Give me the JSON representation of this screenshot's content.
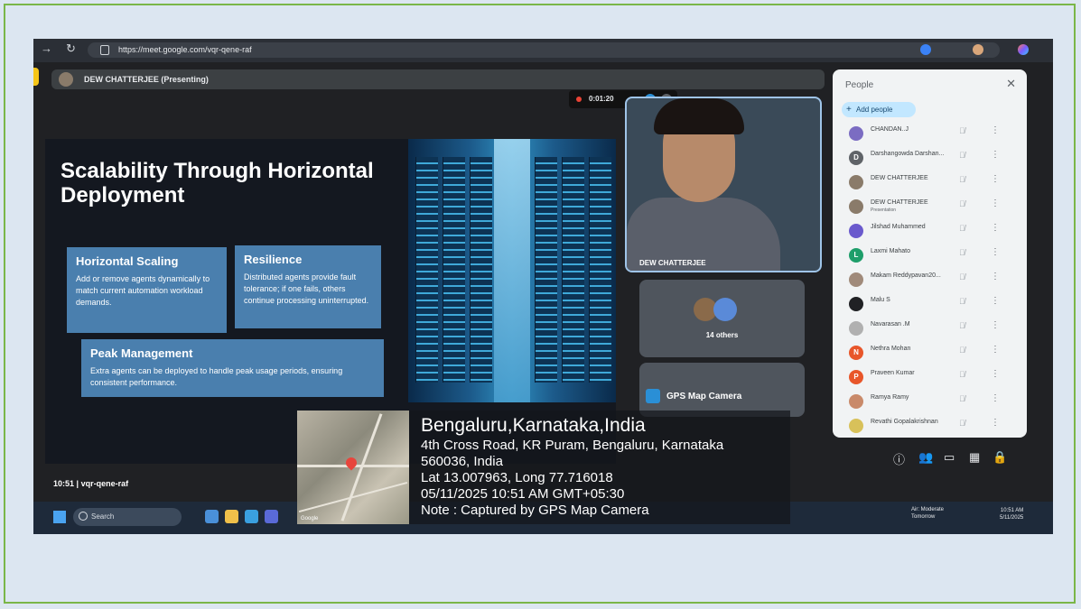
{
  "browser": {
    "url": "https://meet.google.com/vqr-qene-raf"
  },
  "meet": {
    "presenter_label": "DEW CHATTERJEE (Presenting)",
    "record_time": "0:01:20",
    "meeting_time": "10:51",
    "meeting_code": "vqr-qene-raf",
    "main_tile_name": "DEW CHATTERJEE",
    "others_label": "14 others",
    "gps_tile_label": "GPS Map Camera"
  },
  "slide": {
    "title": "Scalability Through Horizontal Deployment",
    "cards": [
      {
        "heading": "Horizontal Scaling",
        "body": "Add or remove agents dynamically to match current automation workload demands."
      },
      {
        "heading": "Resilience",
        "body": "Distributed agents provide fault tolerance; if one fails, others continue processing uninterrupted."
      },
      {
        "heading": "Peak Management",
        "body": "Extra agents can be deployed to handle peak usage periods, ensuring consistent performance."
      }
    ]
  },
  "people": {
    "title": "People",
    "add_label": "Add people",
    "list": [
      {
        "name": "CHANDAN..J",
        "sub": "",
        "initial": "",
        "color": "#7b6cc2"
      },
      {
        "name": "Darshangowda Darshan...",
        "sub": "",
        "initial": "D",
        "color": "#5f6368"
      },
      {
        "name": "DEW CHATTERJEE",
        "sub": "",
        "initial": "",
        "color": "#8a7b6a"
      },
      {
        "name": "DEW CHATTERJEE",
        "sub": "Presentation",
        "initial": "",
        "color": "#8a7b6a"
      },
      {
        "name": "Jilshad Muhammed",
        "sub": "",
        "initial": "",
        "color": "#6a5acd"
      },
      {
        "name": "Laxmi Mahato",
        "sub": "",
        "initial": "L",
        "color": "#1e9e6a"
      },
      {
        "name": "Makam Reddypavan20...",
        "sub": "",
        "initial": "",
        "color": "#a08a7a"
      },
      {
        "name": "Malu S",
        "sub": "",
        "initial": "",
        "color": "#202124"
      },
      {
        "name": "Navarasan .M",
        "sub": "",
        "initial": "",
        "color": "#b0b0b0"
      },
      {
        "name": "Nethra Mohan",
        "sub": "",
        "initial": "N",
        "color": "#e8562a"
      },
      {
        "name": "Praveen Kumar",
        "sub": "",
        "initial": "P",
        "color": "#e8562a"
      },
      {
        "name": "Ramya Ramy",
        "sub": "",
        "initial": "",
        "color": "#c98a6a"
      },
      {
        "name": "Revathi Gopalakrishnan",
        "sub": "",
        "initial": "",
        "color": "#d8c15a"
      }
    ]
  },
  "taskbar": {
    "search_placeholder": "Search",
    "air_line1": "Air: Moderate",
    "air_line2": "Tomorrow",
    "clock_time": "10:51 AM",
    "clock_date": "5/11/2025"
  },
  "gps": {
    "city": "Bengaluru,Karnataka,India",
    "address": "4th Cross Road, KR Puram, Bengaluru, Karnataka",
    "postal": "560036, India",
    "coords": "Lat 13.007963, Long 77.716018",
    "datetime": "05/11/2025 10:51 AM GMT+05:30",
    "note": "Note : Captured by GPS Map Camera",
    "map_label": "Google"
  }
}
